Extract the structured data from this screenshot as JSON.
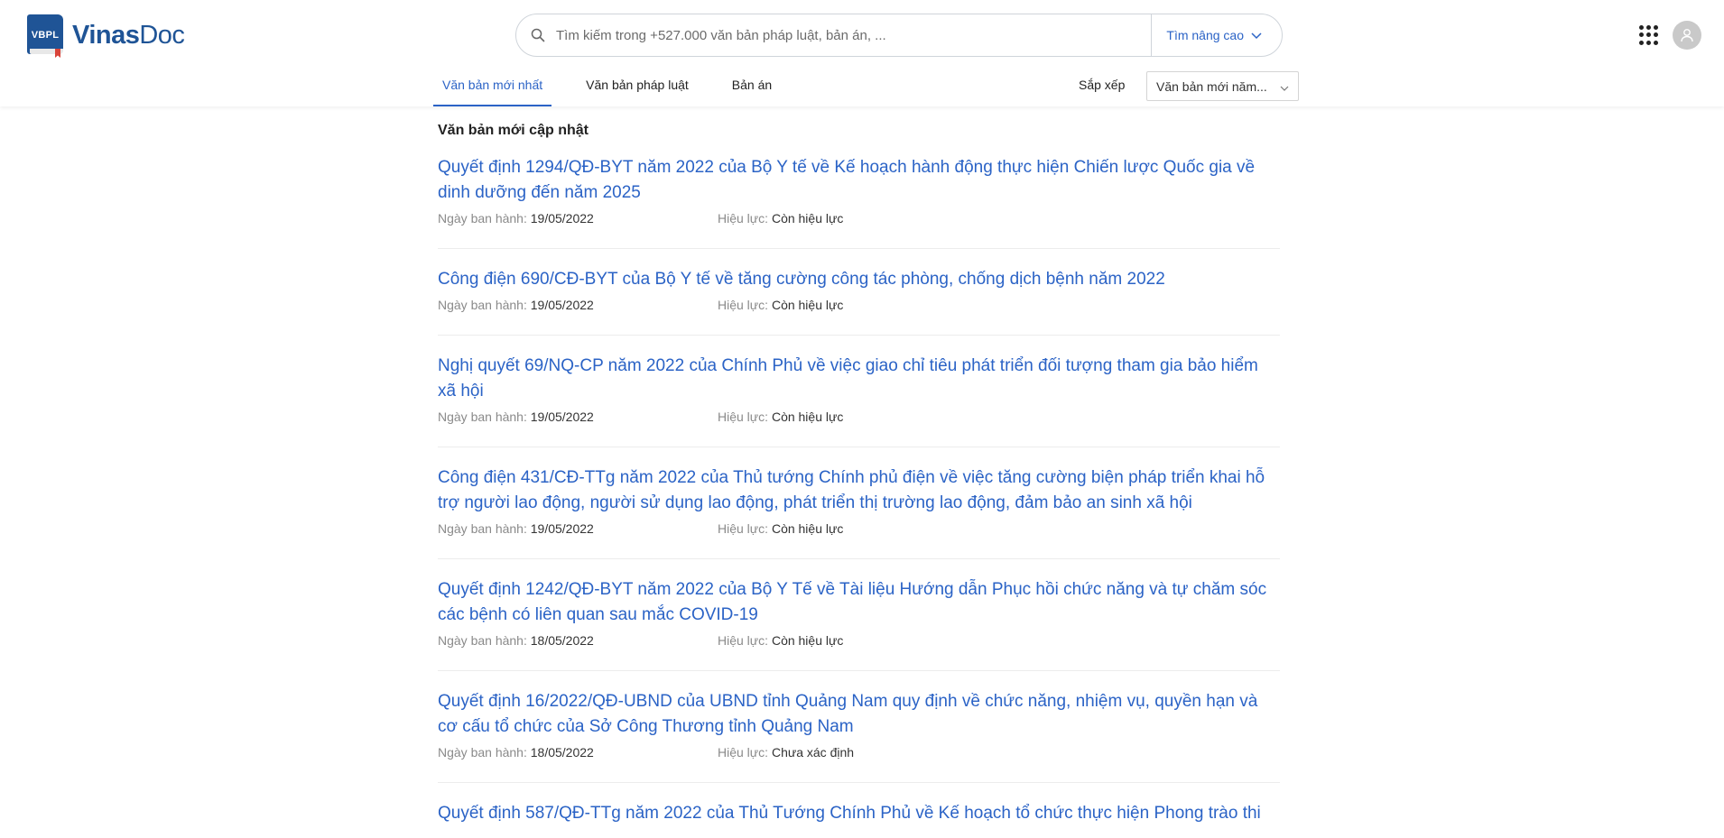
{
  "header": {
    "logo_badge": "VBPL",
    "logo_word1": "Vinas",
    "logo_word2": "Doc",
    "search_placeholder": "Tìm kiếm trong +527.000 văn bản pháp luật, bản án, ...",
    "advanced_search_label": "Tìm nâng cao"
  },
  "tabs": [
    {
      "label": "Văn bản mới nhất",
      "active": true
    },
    {
      "label": "Văn bản pháp luật",
      "active": false
    },
    {
      "label": "Bản án",
      "active": false
    }
  ],
  "sort": {
    "label": "Sắp xếp",
    "selected": "Văn bản mới năm..."
  },
  "section_title": "Văn bản mới cập nhật",
  "meta_labels": {
    "date": "Ngày ban hành:",
    "status": "Hiệu lực:"
  },
  "documents": [
    {
      "title": "Quyết định 1294/QĐ-BYT năm 2022 của Bộ Y tế về Kế hoạch hành động thực hiện Chiến lược Quốc gia về dinh dưỡng đến năm 2025",
      "date": "19/05/2022",
      "status": "Còn hiệu lực"
    },
    {
      "title": "Công điện 690/CĐ-BYT của Bộ Y tế về tăng cường công tác phòng, chống dịch bệnh năm 2022",
      "date": "19/05/2022",
      "status": "Còn hiệu lực"
    },
    {
      "title": "Nghị quyết 69/NQ-CP năm 2022 của Chính Phủ về việc giao chỉ tiêu phát triển đối tượng tham gia bảo hiểm xã hội",
      "date": "19/05/2022",
      "status": "Còn hiệu lực"
    },
    {
      "title": "Công điện 431/CĐ-TTg năm 2022 của Thủ tướng Chính phủ điện về việc tăng cường biện pháp triển khai hỗ trợ người lao động, người sử dụng lao động, phát triển thị trường lao động, đảm bảo an sinh xã hội",
      "date": "19/05/2022",
      "status": "Còn hiệu lực"
    },
    {
      "title": "Quyết định 1242/QĐ-BYT năm 2022 của Bộ Y Tế về Tài liệu Hướng dẫn Phục hồi chức năng và tự chăm sóc các bệnh có liên quan sau mắc COVID-19",
      "date": "18/05/2022",
      "status": "Còn hiệu lực"
    },
    {
      "title": "Quyết định 16/2022/QĐ-UBND của UBND tỉnh Quảng Nam quy định về chức năng, nhiệm vụ, quyền hạn và cơ cấu tổ chức của Sở Công Thương tỉnh Quảng Nam",
      "date": "18/05/2022",
      "status": "Chưa xác định"
    },
    {
      "title": "Quyết định 587/QĐ-TTg năm 2022 của Thủ Tướng Chính Phủ về Kế hoạch tổ chức thực hiện Phong trào thi",
      "date": "",
      "status": ""
    }
  ],
  "colors": {
    "brand": "#1f5496",
    "link": "#2b63c6",
    "meta_label": "#8a8a8a"
  },
  "icons": {
    "search": "search-icon",
    "advanced_chevron": "chevron-down-icon",
    "apps": "apps-grid-icon",
    "account": "user-avatar-icon"
  }
}
